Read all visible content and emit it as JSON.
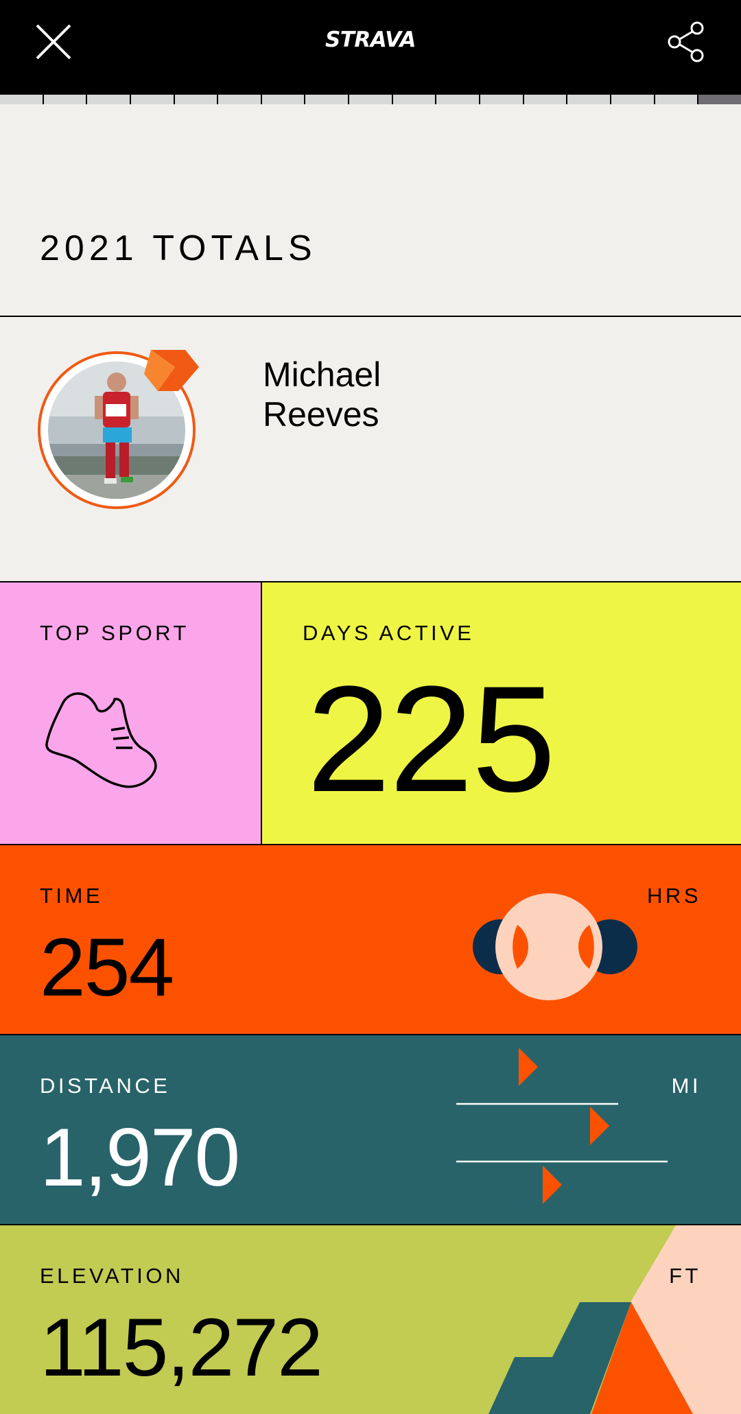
{
  "header": {
    "logo_text": "STRAVA",
    "close_icon": "close-icon",
    "share_icon": "share-icon"
  },
  "progress": {
    "segments_total": 17,
    "current_index": 16
  },
  "totals": {
    "title": "2021 TOTALS"
  },
  "profile": {
    "first_name": "Michael",
    "last_name": "Reeves"
  },
  "top_sport": {
    "label": "TOP SPORT",
    "icon": "running-shoe-icon"
  },
  "days_active": {
    "label": "DAYS ACTIVE",
    "value": "225"
  },
  "time": {
    "label": "TIME",
    "unit": "HRS",
    "value": "254"
  },
  "distance": {
    "label": "DISTANCE",
    "unit": "MI",
    "value": "1,970"
  },
  "elevation": {
    "label": "ELEVATION",
    "unit": "FT",
    "value": "115,272"
  },
  "colors": {
    "pink": "#fba6ea",
    "yellow": "#eff545",
    "orange": "#fc5200",
    "teal": "#28636a",
    "olive": "#c2cb52",
    "peach": "#fdd3bd",
    "navy": "#0b2d4a"
  }
}
